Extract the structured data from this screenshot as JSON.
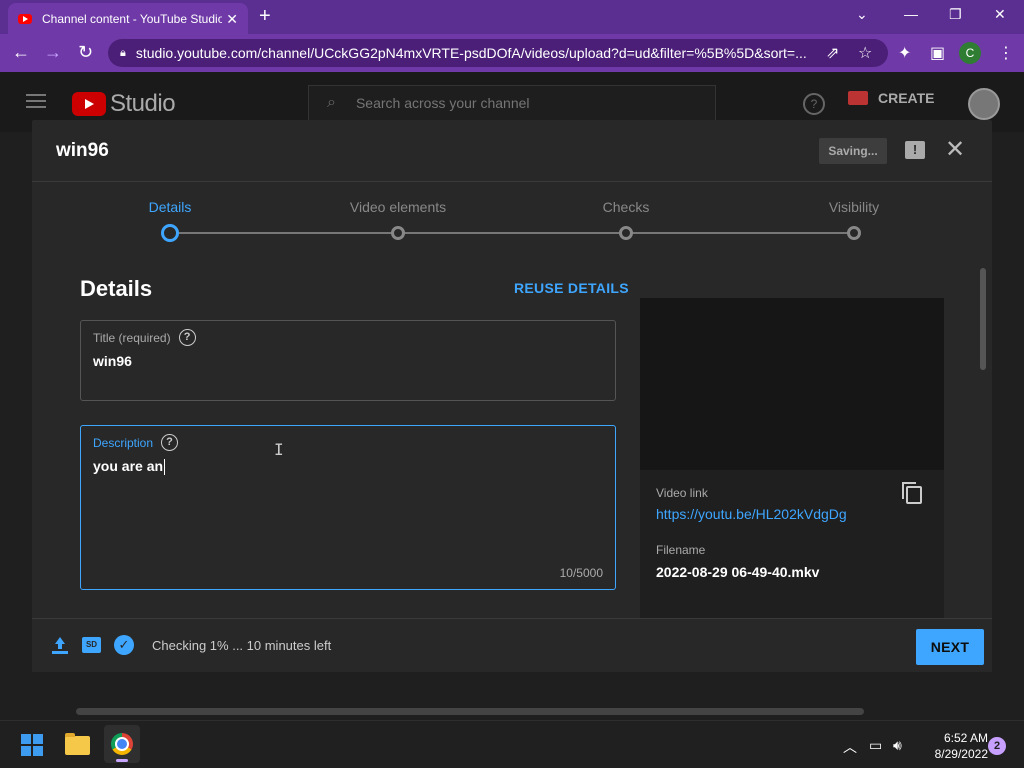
{
  "browser": {
    "tab_title": "Channel content - YouTube Studio",
    "tab_close": "✕",
    "new_tab": "+",
    "url": "studio.youtube.com/channel/UCckGG2pN4mxVRTE-psdDOfA/videos/upload?d=ud&filter=%5B%5D&sort=...",
    "profile_letter": "C",
    "accent": "#6f3aa8"
  },
  "studio": {
    "logo_text": "Studio",
    "search_placeholder": "Search across your channel",
    "create_label": "CREATE"
  },
  "dialog": {
    "title": "win96",
    "saving_label": "Saving...",
    "steps": [
      {
        "label": "Details"
      },
      {
        "label": "Video elements"
      },
      {
        "label": "Checks"
      },
      {
        "label": "Visibility"
      }
    ],
    "section_title": "Details",
    "reuse_label": "REUSE DETAILS",
    "title_field": {
      "label": "Title (required)",
      "value": "win96"
    },
    "description_field": {
      "label": "Description",
      "value": "you are an",
      "counter": "10/5000"
    },
    "video_link_label": "Video link",
    "video_link": "https://youtu.be/HL202kVdgDg",
    "filename_label": "Filename",
    "filename": "2022-08-29 06-49-40.mkv",
    "status_text": "Checking 1% ... 10 minutes left",
    "next_label": "NEXT",
    "sd_badge": "SD"
  },
  "taskbar": {
    "time": "6:52 AM",
    "date": "8/29/2022",
    "notification_count": "2"
  }
}
